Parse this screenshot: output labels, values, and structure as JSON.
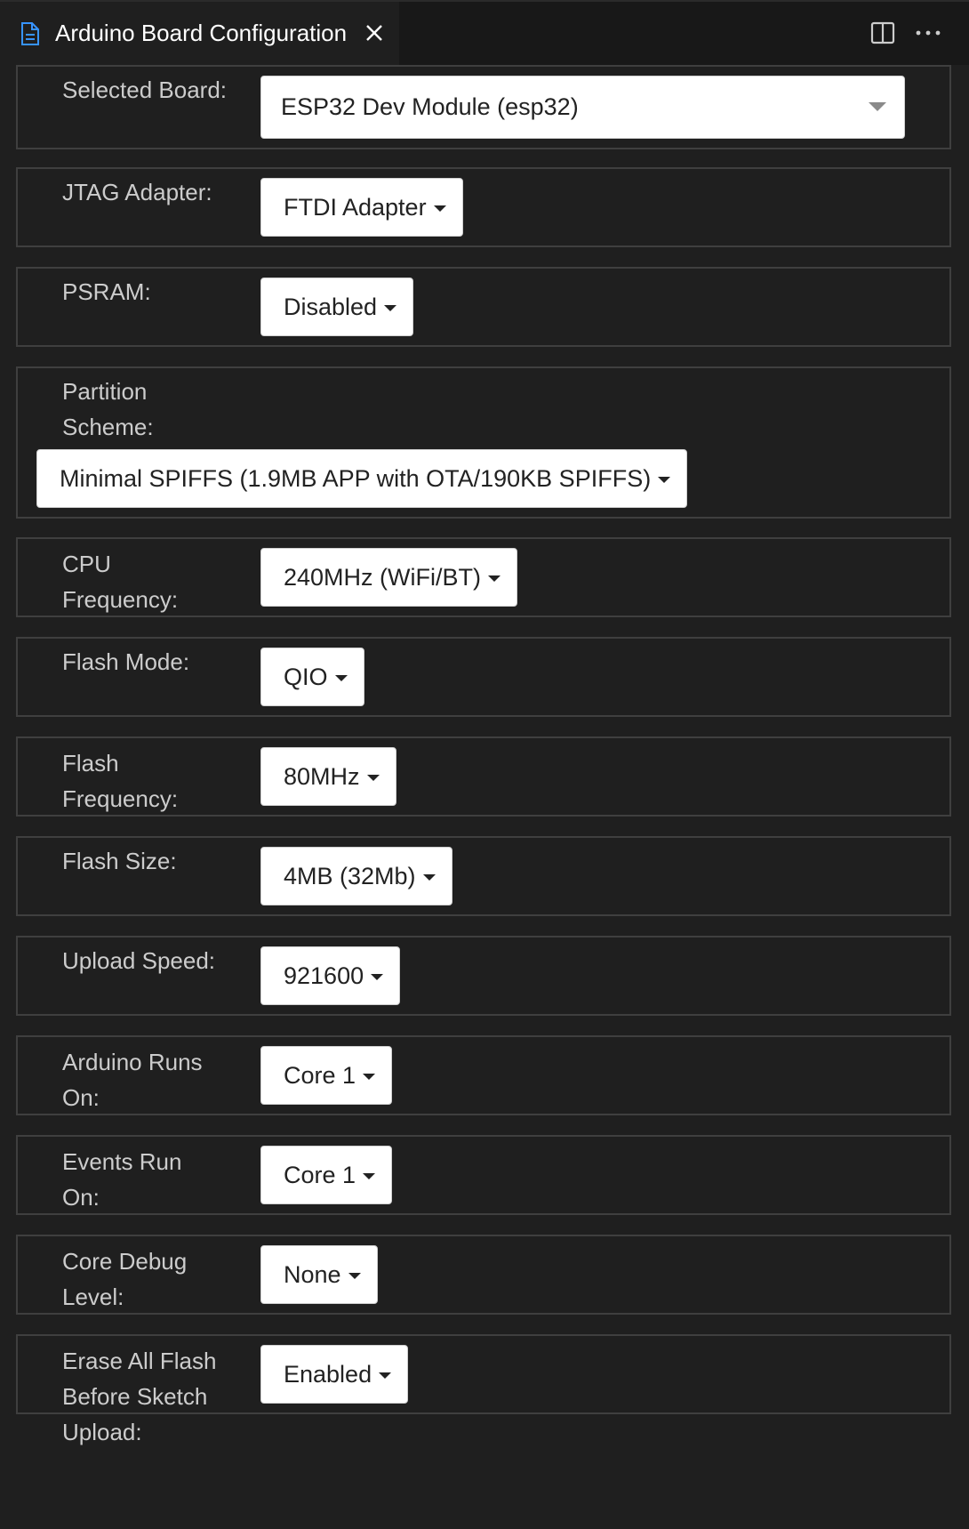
{
  "tab": {
    "title": "Arduino Board Configuration",
    "file_icon": "file-icon",
    "close_icon": "close-icon"
  },
  "toolbar": {
    "split_icon": "split-editor-icon",
    "more_icon": "more-actions-icon"
  },
  "colors": {
    "background": "#1f1f1f",
    "titlebar": "#181818",
    "border": "#3f3f3f",
    "accent_icon": "#3794ff"
  },
  "selected_board": {
    "label": "Selected Board:",
    "value": "ESP32 Dev Module (esp32)"
  },
  "options": [
    {
      "label": "JTAG Adapter:",
      "value": "FTDI Adapter"
    },
    {
      "label": "PSRAM:",
      "value": "Disabled"
    },
    {
      "label": "Partition Scheme:",
      "value": "Minimal SPIFFS (1.9MB APP with OTA/190KB SPIFFS)"
    },
    {
      "label": "CPU Frequency:",
      "value": "240MHz (WiFi/BT)"
    },
    {
      "label": "Flash Mode:",
      "value": "QIO"
    },
    {
      "label": "Flash Frequency:",
      "value": "80MHz"
    },
    {
      "label": "Flash Size:",
      "value": "4MB (32Mb)"
    },
    {
      "label": "Upload Speed:",
      "value": "921600"
    },
    {
      "label": "Arduino Runs On:",
      "value": "Core 1"
    },
    {
      "label": "Events Run On:",
      "value": "Core 1"
    },
    {
      "label": "Core Debug Level:",
      "value": "None"
    },
    {
      "label": "Erase All Flash Before Sketch Upload:",
      "value": "Enabled"
    }
  ]
}
